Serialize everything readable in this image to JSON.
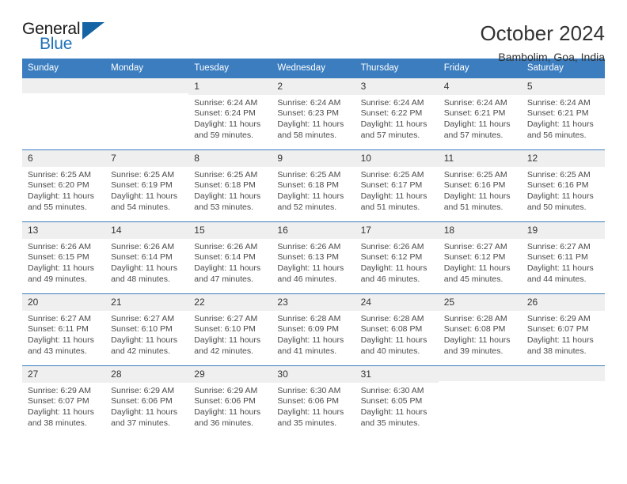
{
  "brand": {
    "word_one": "General",
    "word_two": "Blue",
    "triangle_icon": "blue-triangle-icon",
    "accent_color": "#1d70b8",
    "triangle_color": "#1464a5"
  },
  "header": {
    "title": "October 2024",
    "subtitle": "Bambolim, Goa, India"
  },
  "calendar": {
    "header_bg": "#3b7dbf",
    "daynum_bg": "#efefef",
    "weekday_headers": [
      "Sunday",
      "Monday",
      "Tuesday",
      "Wednesday",
      "Thursday",
      "Friday",
      "Saturday"
    ],
    "weeks": [
      [
        {
          "day": "",
          "sunrise": "",
          "sunset": "",
          "daylight_1": "",
          "daylight_2": ""
        },
        {
          "day": "",
          "sunrise": "",
          "sunset": "",
          "daylight_1": "",
          "daylight_2": ""
        },
        {
          "day": "1",
          "sunrise": "Sunrise: 6:24 AM",
          "sunset": "Sunset: 6:24 PM",
          "daylight_1": "Daylight: 11 hours",
          "daylight_2": "and 59 minutes."
        },
        {
          "day": "2",
          "sunrise": "Sunrise: 6:24 AM",
          "sunset": "Sunset: 6:23 PM",
          "daylight_1": "Daylight: 11 hours",
          "daylight_2": "and 58 minutes."
        },
        {
          "day": "3",
          "sunrise": "Sunrise: 6:24 AM",
          "sunset": "Sunset: 6:22 PM",
          "daylight_1": "Daylight: 11 hours",
          "daylight_2": "and 57 minutes."
        },
        {
          "day": "4",
          "sunrise": "Sunrise: 6:24 AM",
          "sunset": "Sunset: 6:21 PM",
          "daylight_1": "Daylight: 11 hours",
          "daylight_2": "and 57 minutes."
        },
        {
          "day": "5",
          "sunrise": "Sunrise: 6:24 AM",
          "sunset": "Sunset: 6:21 PM",
          "daylight_1": "Daylight: 11 hours",
          "daylight_2": "and 56 minutes."
        }
      ],
      [
        {
          "day": "6",
          "sunrise": "Sunrise: 6:25 AM",
          "sunset": "Sunset: 6:20 PM",
          "daylight_1": "Daylight: 11 hours",
          "daylight_2": "and 55 minutes."
        },
        {
          "day": "7",
          "sunrise": "Sunrise: 6:25 AM",
          "sunset": "Sunset: 6:19 PM",
          "daylight_1": "Daylight: 11 hours",
          "daylight_2": "and 54 minutes."
        },
        {
          "day": "8",
          "sunrise": "Sunrise: 6:25 AM",
          "sunset": "Sunset: 6:18 PM",
          "daylight_1": "Daylight: 11 hours",
          "daylight_2": "and 53 minutes."
        },
        {
          "day": "9",
          "sunrise": "Sunrise: 6:25 AM",
          "sunset": "Sunset: 6:18 PM",
          "daylight_1": "Daylight: 11 hours",
          "daylight_2": "and 52 minutes."
        },
        {
          "day": "10",
          "sunrise": "Sunrise: 6:25 AM",
          "sunset": "Sunset: 6:17 PM",
          "daylight_1": "Daylight: 11 hours",
          "daylight_2": "and 51 minutes."
        },
        {
          "day": "11",
          "sunrise": "Sunrise: 6:25 AM",
          "sunset": "Sunset: 6:16 PM",
          "daylight_1": "Daylight: 11 hours",
          "daylight_2": "and 51 minutes."
        },
        {
          "day": "12",
          "sunrise": "Sunrise: 6:25 AM",
          "sunset": "Sunset: 6:16 PM",
          "daylight_1": "Daylight: 11 hours",
          "daylight_2": "and 50 minutes."
        }
      ],
      [
        {
          "day": "13",
          "sunrise": "Sunrise: 6:26 AM",
          "sunset": "Sunset: 6:15 PM",
          "daylight_1": "Daylight: 11 hours",
          "daylight_2": "and 49 minutes."
        },
        {
          "day": "14",
          "sunrise": "Sunrise: 6:26 AM",
          "sunset": "Sunset: 6:14 PM",
          "daylight_1": "Daylight: 11 hours",
          "daylight_2": "and 48 minutes."
        },
        {
          "day": "15",
          "sunrise": "Sunrise: 6:26 AM",
          "sunset": "Sunset: 6:14 PM",
          "daylight_1": "Daylight: 11 hours",
          "daylight_2": "and 47 minutes."
        },
        {
          "day": "16",
          "sunrise": "Sunrise: 6:26 AM",
          "sunset": "Sunset: 6:13 PM",
          "daylight_1": "Daylight: 11 hours",
          "daylight_2": "and 46 minutes."
        },
        {
          "day": "17",
          "sunrise": "Sunrise: 6:26 AM",
          "sunset": "Sunset: 6:12 PM",
          "daylight_1": "Daylight: 11 hours",
          "daylight_2": "and 46 minutes."
        },
        {
          "day": "18",
          "sunrise": "Sunrise: 6:27 AM",
          "sunset": "Sunset: 6:12 PM",
          "daylight_1": "Daylight: 11 hours",
          "daylight_2": "and 45 minutes."
        },
        {
          "day": "19",
          "sunrise": "Sunrise: 6:27 AM",
          "sunset": "Sunset: 6:11 PM",
          "daylight_1": "Daylight: 11 hours",
          "daylight_2": "and 44 minutes."
        }
      ],
      [
        {
          "day": "20",
          "sunrise": "Sunrise: 6:27 AM",
          "sunset": "Sunset: 6:11 PM",
          "daylight_1": "Daylight: 11 hours",
          "daylight_2": "and 43 minutes."
        },
        {
          "day": "21",
          "sunrise": "Sunrise: 6:27 AM",
          "sunset": "Sunset: 6:10 PM",
          "daylight_1": "Daylight: 11 hours",
          "daylight_2": "and 42 minutes."
        },
        {
          "day": "22",
          "sunrise": "Sunrise: 6:27 AM",
          "sunset": "Sunset: 6:10 PM",
          "daylight_1": "Daylight: 11 hours",
          "daylight_2": "and 42 minutes."
        },
        {
          "day": "23",
          "sunrise": "Sunrise: 6:28 AM",
          "sunset": "Sunset: 6:09 PM",
          "daylight_1": "Daylight: 11 hours",
          "daylight_2": "and 41 minutes."
        },
        {
          "day": "24",
          "sunrise": "Sunrise: 6:28 AM",
          "sunset": "Sunset: 6:08 PM",
          "daylight_1": "Daylight: 11 hours",
          "daylight_2": "and 40 minutes."
        },
        {
          "day": "25",
          "sunrise": "Sunrise: 6:28 AM",
          "sunset": "Sunset: 6:08 PM",
          "daylight_1": "Daylight: 11 hours",
          "daylight_2": "and 39 minutes."
        },
        {
          "day": "26",
          "sunrise": "Sunrise: 6:29 AM",
          "sunset": "Sunset: 6:07 PM",
          "daylight_1": "Daylight: 11 hours",
          "daylight_2": "and 38 minutes."
        }
      ],
      [
        {
          "day": "27",
          "sunrise": "Sunrise: 6:29 AM",
          "sunset": "Sunset: 6:07 PM",
          "daylight_1": "Daylight: 11 hours",
          "daylight_2": "and 38 minutes."
        },
        {
          "day": "28",
          "sunrise": "Sunrise: 6:29 AM",
          "sunset": "Sunset: 6:06 PM",
          "daylight_1": "Daylight: 11 hours",
          "daylight_2": "and 37 minutes."
        },
        {
          "day": "29",
          "sunrise": "Sunrise: 6:29 AM",
          "sunset": "Sunset: 6:06 PM",
          "daylight_1": "Daylight: 11 hours",
          "daylight_2": "and 36 minutes."
        },
        {
          "day": "30",
          "sunrise": "Sunrise: 6:30 AM",
          "sunset": "Sunset: 6:06 PM",
          "daylight_1": "Daylight: 11 hours",
          "daylight_2": "and 35 minutes."
        },
        {
          "day": "31",
          "sunrise": "Sunrise: 6:30 AM",
          "sunset": "Sunset: 6:05 PM",
          "daylight_1": "Daylight: 11 hours",
          "daylight_2": "and 35 minutes."
        },
        {
          "day": "",
          "sunrise": "",
          "sunset": "",
          "daylight_1": "",
          "daylight_2": ""
        },
        {
          "day": "",
          "sunrise": "",
          "sunset": "",
          "daylight_1": "",
          "daylight_2": ""
        }
      ]
    ]
  }
}
